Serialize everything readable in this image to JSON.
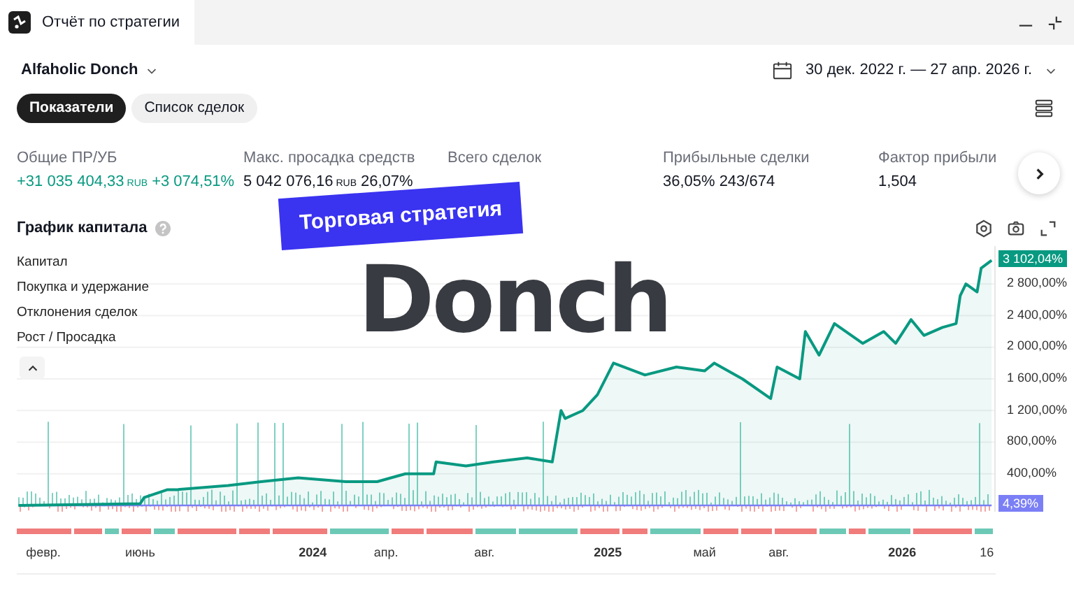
{
  "window": {
    "title": "Отчёт по стратегии"
  },
  "strategy": {
    "name": "Alfaholic Donch"
  },
  "date_range": "30 дек. 2022 г. — 27 апр. 2026 г.",
  "tabs": [
    {
      "label": "Показатели",
      "selected": true
    },
    {
      "label": "Список сделок",
      "selected": false
    }
  ],
  "metrics": [
    {
      "label": "Общие ПР/УБ",
      "values": [
        {
          "text": "+31 035 404,33",
          "unit": "RUB",
          "positive": true
        },
        {
          "text": "+3 074,51%",
          "positive": true
        }
      ]
    },
    {
      "label": "Макс. просадка средств",
      "values": [
        {
          "text": "5 042 076,16",
          "unit": "RUB",
          "positive": false
        },
        {
          "text": "26,07%",
          "positive": false
        }
      ]
    },
    {
      "label": "Всего сделок"
    },
    {
      "label": "Прибыльные сделки",
      "values": [
        {
          "text": "36,05%",
          "positive": false
        },
        {
          "text": "243/674",
          "positive": false
        }
      ]
    },
    {
      "label": "Фактор прибыли",
      "values": [
        {
          "text": "1,504",
          "positive": false
        }
      ]
    }
  ],
  "chart": {
    "title": "График капитала",
    "legend": [
      "Капитал",
      "Покупка и удержание",
      "Отклонения сделок",
      "Рост / Просадка"
    ],
    "price_labels": [
      {
        "text": "3 102,04%",
        "kind": "equity"
      },
      {
        "text": "4,39%",
        "kind": "buy_hold"
      }
    ],
    "chart_data": {
      "type": "line",
      "x": [
        "2023-01-01",
        "2023-06-01",
        "2023-06-06",
        "2023-07-05",
        "2023-07-17",
        "2023-09-18",
        "2023-10-29",
        "2023-12-14",
        "2024-02-11",
        "2024-03-21",
        "2024-04-25",
        "2024-05-30",
        "2024-06-02",
        "2024-07-09",
        "2024-08-12",
        "2024-09-23",
        "2024-10-24",
        "2024-11-04",
        "2024-11-09",
        "2024-12-01",
        "2024-12-19",
        "2025-01-08",
        "2025-02-16",
        "2025-03-27",
        "2025-05-01",
        "2025-05-13",
        "2025-06-17",
        "2025-07-22",
        "2025-07-30",
        "2025-08-27",
        "2025-09-03",
        "2025-09-20",
        "2025-10-09",
        "2025-11-13",
        "2025-12-09",
        "2025-12-24",
        "2026-01-12",
        "2026-01-28",
        "2026-02-20",
        "2026-03-09",
        "2026-03-14",
        "2026-03-21",
        "2026-04-04",
        "2026-04-09",
        "2026-04-22"
      ],
      "series": [
        {
          "color": "#089981",
          "values": [
            0,
            20,
            100,
            200,
            200,
            250,
            300,
            350,
            300,
            300,
            400,
            400,
            550,
            500,
            550,
            600,
            550,
            1200,
            1100,
            1200,
            1400,
            1800,
            1650,
            1750,
            1700,
            1800,
            1600,
            1350,
            1750,
            1600,
            2200,
            1900,
            2300,
            2050,
            2200,
            2050,
            2350,
            2150,
            2250,
            2300,
            2650,
            2800,
            2700,
            3000,
            3100
          ]
        },
        {
          "color": "#7b7ff5",
          "values": [
            0,
            0,
            0,
            0,
            0,
            0,
            0,
            0,
            0,
            0,
            0,
            0,
            0,
            0,
            0,
            0,
            0,
            0,
            0,
            0,
            0,
            0,
            0,
            0,
            0,
            0,
            0,
            0,
            0,
            0,
            0,
            0,
            0,
            0,
            0,
            0,
            0,
            0,
            0,
            0,
            0,
            0,
            0,
            0,
            0
          ]
        }
      ],
      "xlim": [
        "2022-12-30",
        "2026-04-27"
      ],
      "ylim": [
        -80,
        3280
      ],
      "grid": true,
      "xticks": [
        {
          "value": "2023-02-01",
          "label": "февр."
        },
        {
          "value": "2023-06-01",
          "label": "июнь"
        },
        {
          "value": "2024-01-01",
          "label": "2024"
        },
        {
          "value": "2024-04-01",
          "label": "апр."
        },
        {
          "value": "2024-08-01",
          "label": "авг."
        },
        {
          "value": "2025-01-01",
          "label": "2025"
        },
        {
          "value": "2025-05-01",
          "label": "май"
        },
        {
          "value": "2025-08-01",
          "label": "авг."
        },
        {
          "value": "2026-01-01",
          "label": "2026"
        },
        {
          "value": "2026-04-16",
          "label": "16"
        }
      ],
      "yticks": [
        {
          "value": 400,
          "label": "400,00%"
        },
        {
          "value": 800,
          "label": "800,00%"
        },
        {
          "value": 1200,
          "label": "1 200,00%"
        },
        {
          "value": 1600,
          "label": "1 600,00%"
        },
        {
          "value": 2000,
          "label": "2 000,00%"
        },
        {
          "value": 2400,
          "label": "2 400,00%"
        },
        {
          "value": 2800,
          "label": "2 800,00%"
        }
      ]
    }
  },
  "overlay": {
    "banner": "Торговая стратегия",
    "headline": "Donch"
  }
}
